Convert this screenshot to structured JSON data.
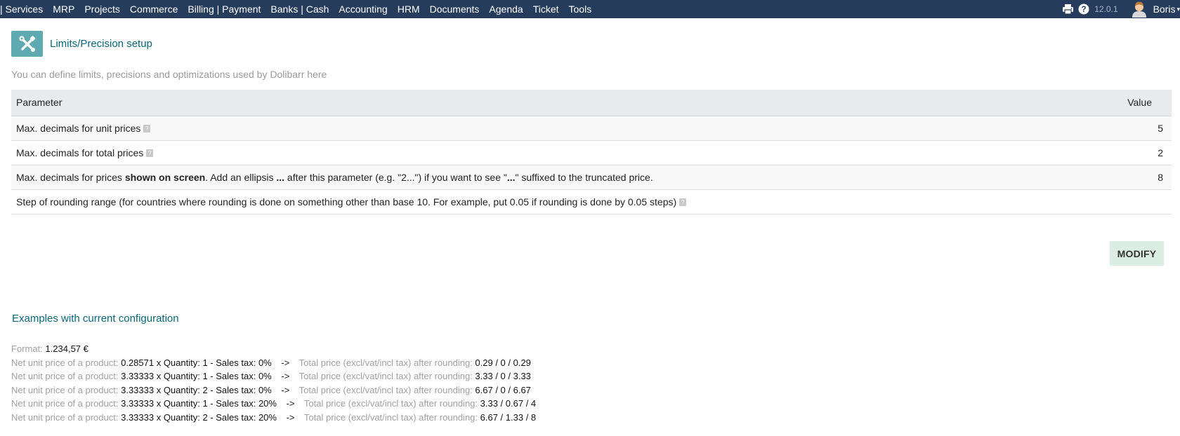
{
  "topbar": {
    "menu": [
      "| Services",
      "MRP",
      "Projects",
      "Commerce",
      "Billing | Payment",
      "Banks | Cash",
      "Accounting",
      "HRM",
      "Documents",
      "Agenda",
      "Ticket",
      "Tools"
    ],
    "version": "12.0.1",
    "username": "Boris"
  },
  "page": {
    "title": "Limits/Precision setup",
    "description": "You can define limits, precisions and optimizations used by Dolibarr here"
  },
  "table": {
    "header_parameter": "Parameter",
    "header_value": "Value",
    "row1_label": "Max. decimals for unit prices",
    "row1_value": "5",
    "row2_label": "Max. decimals for total prices",
    "row2_value": "2",
    "row3_part1": "Max. decimals for prices ",
    "row3_bold": "shown on screen",
    "row3_part2": ". Add an ellipsis ",
    "row3_ellipsis": "...",
    "row3_part3": " after this parameter (e.g. \"2...\") if you want to see \"",
    "row3_ellipsis2": "...",
    "row3_part4": "\" suffixed to the truncated price.",
    "row3_value": "8",
    "row4_label": "Step of rounding range (for countries where rounding is done on something other than base 10. For example, put 0.05 if rounding is done by 0.05 steps)",
    "row4_value": ""
  },
  "buttons": {
    "modify": "MODIFY"
  },
  "examples": {
    "title": "Examples with current configuration",
    "format_label": "Format:",
    "format_value": "1.234,57 €",
    "lines": [
      {
        "l1": "Net unit price of a product:",
        "v1": "0.28571 x Quantity: 1 - Sales tax: 0%",
        "arrow": "->",
        "l2": "Total price (excl/vat/incl tax) after rounding:",
        "v2": "0.29 / 0 / 0.29"
      },
      {
        "l1": "Net unit price of a product:",
        "v1": "3.33333 x Quantity: 1 - Sales tax: 0%",
        "arrow": "->",
        "l2": "Total price (excl/vat/incl tax) after rounding:",
        "v2": "3.33 / 0 / 3.33"
      },
      {
        "l1": "Net unit price of a product:",
        "v1": "3.33333 x Quantity: 2 - Sales tax: 0%",
        "arrow": "->",
        "l2": "Total price (excl/vat/incl tax) after rounding:",
        "v2": "6.67 / 0 / 6.67"
      },
      {
        "l1": "Net unit price of a product:",
        "v1": "3.33333 x Quantity: 1 - Sales tax: 20%",
        "arrow": "->",
        "l2": "Total price (excl/vat/incl tax) after rounding:",
        "v2": "3.33 / 0.67 / 4"
      },
      {
        "l1": "Net unit price of a product:",
        "v1": "3.33333 x Quantity: 2 - Sales tax: 20%",
        "arrow": "->",
        "l2": "Total price (excl/vat/incl tax) after rounding:",
        "v2": "6.67 / 1.33 / 8"
      }
    ]
  },
  "icons": {
    "print": "print-icon",
    "help": "help-icon",
    "avatar": "user-avatar-icon",
    "title": "tools-icon",
    "row_help": "help-badge-icon"
  },
  "colors": {
    "topbar": "#263c5c",
    "title_icon_bg": "#5fa9b0",
    "link_title": "#0a6777",
    "modify_bg": "#dceee4"
  }
}
